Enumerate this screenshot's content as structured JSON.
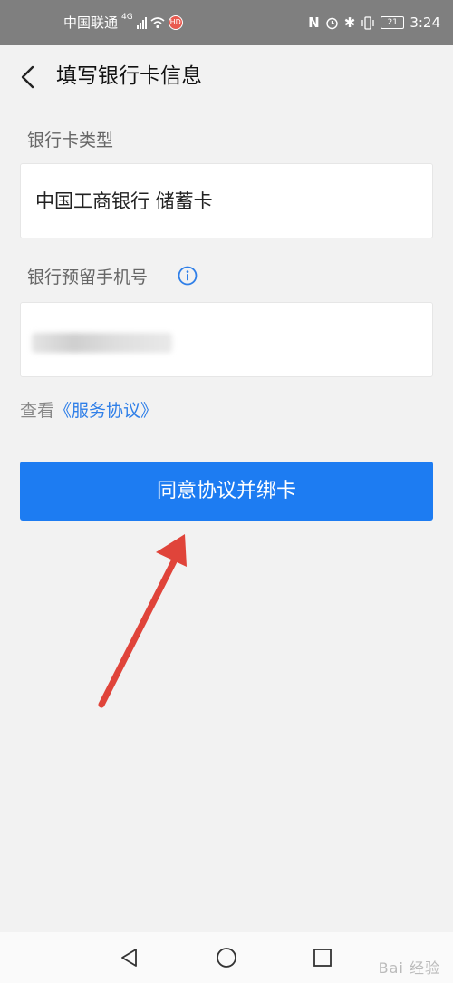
{
  "status_bar": {
    "carrier": "中国联通",
    "network": "4G",
    "time": "3:24",
    "battery": "21"
  },
  "header": {
    "title": "填写银行卡信息",
    "back_icon": "chevron-left-icon"
  },
  "form": {
    "card_type_label": "银行卡类型",
    "card_type_value": "中国工商银行 储蓄卡",
    "phone_label": "银行预留手机号",
    "phone_info_icon": "info-icon"
  },
  "agreement": {
    "prefix": "查看",
    "link": "《服务协议》"
  },
  "primary_button": {
    "label": "同意协议并绑卡"
  },
  "system_nav": {
    "back": "triangle-back-icon",
    "home": "circle-home-icon",
    "recents": "square-recents-icon"
  },
  "watermark": "Bai 经验",
  "colors": {
    "accent": "#1d7cf2",
    "link": "#2f7fe8",
    "status_bar": "#7f7f7f",
    "annotation_arrow": "#e0443a"
  }
}
